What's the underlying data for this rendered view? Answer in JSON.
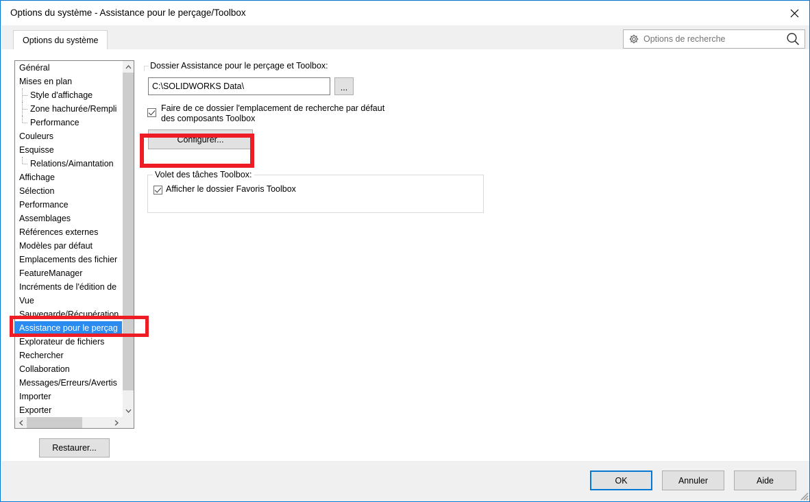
{
  "window": {
    "title": "Options du système - Assistance pour le perçage/Toolbox",
    "close_icon": "close-icon"
  },
  "tabs": [
    {
      "label": "Options du système",
      "active": true
    }
  ],
  "search": {
    "placeholder": "Options de recherche",
    "gear_icon": "gear-icon",
    "magnifier_icon": "search-icon"
  },
  "sidebar": {
    "items": [
      {
        "label": "Général",
        "level": 0,
        "selected": false
      },
      {
        "label": "Mises en plan",
        "level": 0,
        "selected": false
      },
      {
        "label": "Style d'affichage",
        "level": 1,
        "selected": false
      },
      {
        "label": "Zone hachurée/Rempli",
        "level": 1,
        "selected": false
      },
      {
        "label": "Performance",
        "level": 1,
        "selected": false,
        "last": true
      },
      {
        "label": "Couleurs",
        "level": 0,
        "selected": false
      },
      {
        "label": "Esquisse",
        "level": 0,
        "selected": false
      },
      {
        "label": "Relations/Aimantation",
        "level": 1,
        "selected": false,
        "last": true
      },
      {
        "label": "Affichage",
        "level": 0,
        "selected": false
      },
      {
        "label": "Sélection",
        "level": 0,
        "selected": false
      },
      {
        "label": "Performance",
        "level": 0,
        "selected": false
      },
      {
        "label": "Assemblages",
        "level": 0,
        "selected": false
      },
      {
        "label": "Références externes",
        "level": 0,
        "selected": false
      },
      {
        "label": "Modèles par défaut",
        "level": 0,
        "selected": false
      },
      {
        "label": "Emplacements des fichier",
        "level": 0,
        "selected": false
      },
      {
        "label": "FeatureManager",
        "level": 0,
        "selected": false
      },
      {
        "label": "Incréments de l'édition de",
        "level": 0,
        "selected": false
      },
      {
        "label": "Vue",
        "level": 0,
        "selected": false
      },
      {
        "label": "Sauvegarde/Récupération",
        "level": 0,
        "selected": false
      },
      {
        "label": "Assistance pour le perçag",
        "level": 0,
        "selected": true
      },
      {
        "label": "Explorateur de fichiers",
        "level": 0,
        "selected": false
      },
      {
        "label": "Rechercher",
        "level": 0,
        "selected": false
      },
      {
        "label": "Collaboration",
        "level": 0,
        "selected": false
      },
      {
        "label": "Messages/Erreurs/Avertis",
        "level": 0,
        "selected": false
      },
      {
        "label": "Importer",
        "level": 0,
        "selected": false
      },
      {
        "label": "Exporter",
        "level": 0,
        "selected": false
      }
    ],
    "restore_label": "Restaurer..."
  },
  "content": {
    "folder_group_label": "Dossier Assistance pour le perçage et Toolbox:",
    "path_value": "C:\\SOLIDWORKS Data\\",
    "browse_label": "...",
    "default_search_checkbox": {
      "checked": true,
      "line1": "Faire de ce dossier l'emplacement de recherche par défaut",
      "line2": "des composants Toolbox"
    },
    "configure_label": "Configurer...",
    "task_pane_group_label": "Volet des tâches Toolbox:",
    "favorites_checkbox": {
      "checked": true,
      "label": "Afficher le dossier Favoris Toolbox"
    }
  },
  "footer": {
    "ok_label": "OK",
    "cancel_label": "Annuler",
    "help_label": "Aide"
  },
  "colors": {
    "accent": "#0078d7",
    "selection": "#2a8cf0",
    "annotation_red": "#ee1c25",
    "button_face": "#e1e1e1",
    "panel": "#f0f0f0"
  }
}
